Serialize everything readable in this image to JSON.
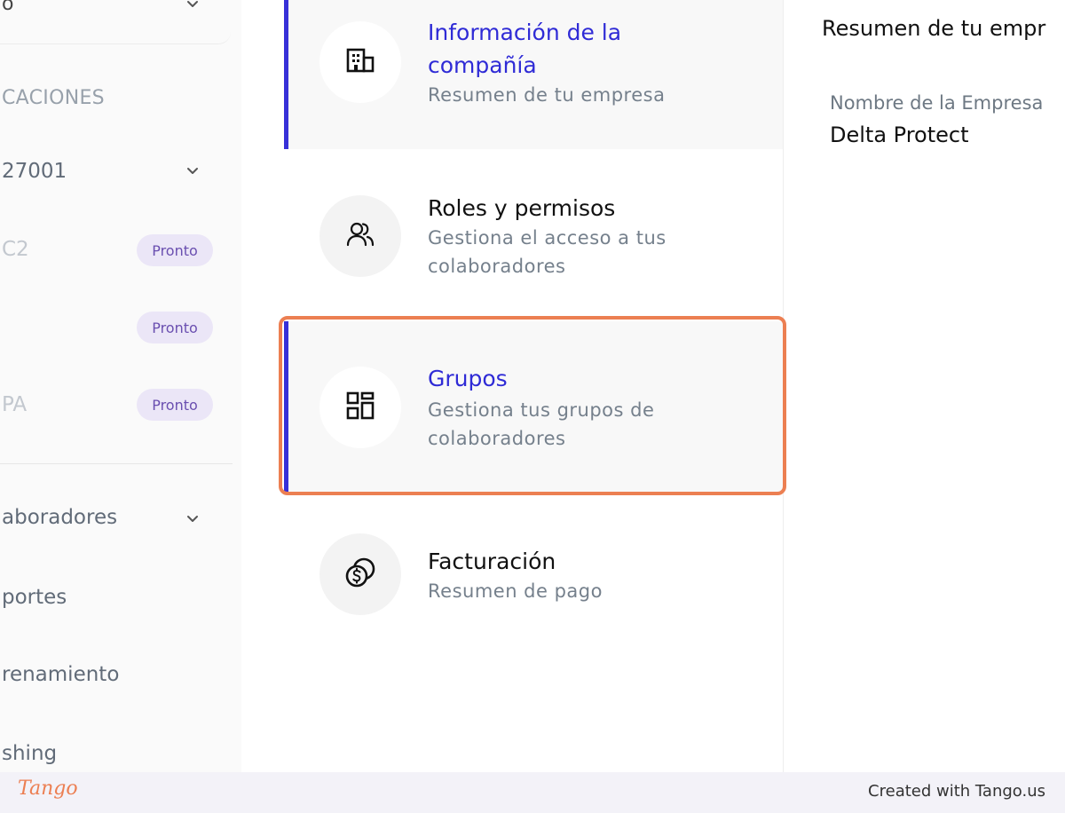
{
  "sidebar": {
    "top_partial_text": "o",
    "section_label": "CACIONES",
    "items": [
      {
        "label": "27001",
        "muted": false
      },
      {
        "label": "C2",
        "badge": "Pronto",
        "muted": true
      },
      {
        "label": "",
        "badge": "Pronto",
        "muted": true
      },
      {
        "label": "PA",
        "badge": "Pronto",
        "muted": true
      },
      {
        "label": "aboradores",
        "muted": false
      },
      {
        "label": "portes",
        "muted": false
      },
      {
        "label": "renamiento",
        "muted": false
      },
      {
        "label": "shing",
        "muted": false
      }
    ]
  },
  "menu": {
    "items": [
      {
        "title_line1": "Información de la",
        "title_line2": "compañía",
        "subtitle": "Resumen de tu empresa",
        "icon": "building-icon",
        "active": true
      },
      {
        "title": "Roles y permisos",
        "subtitle_line1": "Gestiona el acceso a tus",
        "subtitle_line2": "colaboradores",
        "icon": "users-icon",
        "active": false
      },
      {
        "title": "Grupos",
        "subtitle_line1": "Gestiona tus grupos de",
        "subtitle_line2": "colaboradores",
        "icon": "grid-icon",
        "active": true
      },
      {
        "title": "Facturación",
        "subtitle": "Resumen de pago",
        "icon": "coins-icon",
        "active": false
      }
    ]
  },
  "right_panel": {
    "title": "Resumen de tu empr",
    "field_label": "Nombre de la Empresa",
    "field_value": "Delta Protect"
  },
  "footer": {
    "logo_text": "Tango",
    "created_with": "Created with Tango.us"
  },
  "colors": {
    "accent_blue": "#2f2bd6",
    "highlight_orange": "#ec7f52",
    "badge_bg": "#ebe6f7",
    "badge_text": "#6a4fb0"
  }
}
